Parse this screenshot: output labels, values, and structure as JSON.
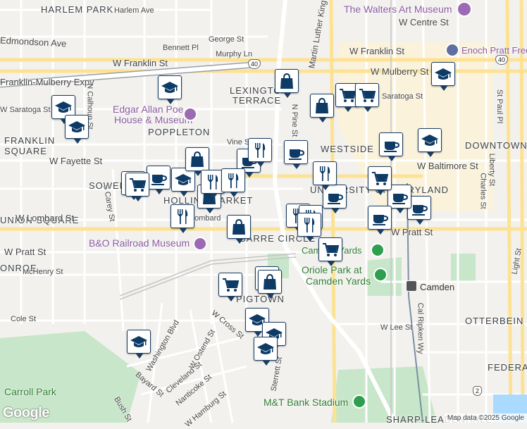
{
  "neighborhoods": [
    "HARLEM PARK",
    "LEXINGTON",
    "TERRACE",
    "POPPLETON",
    "FRANKLIN",
    "SQUARE",
    "WESTSIDE",
    "DOWNTOWN",
    "SOWEB",
    "HOLLINS MARKET",
    "UNION SQUARE",
    "BARRE CIRCLE",
    "PIGTOWN",
    "ONROE",
    "OTTERBEIN",
    "FEDERAL",
    "SHARP-LEADENHALL",
    "UNIVERSITY OF MARYLAND"
  ],
  "streets": [
    "Harlem Ave",
    "Edmondson Ave",
    "George St",
    "Bennett Pl",
    "Murphy Ln",
    "W Franklin St",
    "Franklin-Mulberry Expy",
    "W Franklin St",
    "W Mulberry St",
    "W Saratoga St",
    "Saratoga St",
    "Vine St",
    "W Fayette St",
    "W Baltimore St",
    "W Lombard St",
    "Lombard",
    "W Pratt St",
    "W Pratt St",
    "McHenry St",
    "Cole St",
    "W Cross St",
    "W Ostend St",
    "Washington Blvd",
    "Cleveland St",
    "Nanticoke St",
    "W Hamburg St",
    "Bayard St",
    "Bush St",
    "Sterrett St",
    "W Lee St",
    "Cal Ripken Wy",
    "Charles St",
    "Light St",
    "St Paul Pl",
    "Liberty St",
    "W Centre St",
    "S Carey St",
    "Martin Luther King Jr Blvd",
    "N Pine St",
    "W Pratt St",
    "W Mulberry St",
    "N Calhoun St",
    "W Baltimore St",
    "Charles St",
    "Ave",
    "Lexington"
  ],
  "pois": {
    "walters": "The Walters Art Museum",
    "pratt": "Enoch Pratt Free",
    "poe_line1": "Edgar Allan Poe",
    "poe_line2": "House & Museum",
    "bo": "B&O Railroad Museum",
    "camden_yards": "Camden Yards",
    "oriole_line1": "Oriole Park at",
    "oriole_line2": "Camden Yards",
    "camden": "Camden",
    "mt_bank": "M&T Bank Stadium",
    "carroll_park": "Carroll Park",
    "university_line1": "University",
    "university_line2": "of Baltimore",
    "maryland": "Maryland"
  },
  "shields": [
    "40",
    "40",
    "2"
  ],
  "pins": [
    {
      "type": "school"
    },
    {
      "type": "school"
    },
    {
      "type": "school"
    },
    {
      "type": "school"
    },
    {
      "type": "school"
    },
    {
      "type": "school"
    },
    {
      "type": "school"
    },
    {
      "type": "school"
    },
    {
      "type": "school"
    },
    {
      "type": "school"
    },
    {
      "type": "shop"
    },
    {
      "type": "shop"
    },
    {
      "type": "shop"
    },
    {
      "type": "shop"
    },
    {
      "type": "shop"
    },
    {
      "type": "shop"
    },
    {
      "type": "shop"
    },
    {
      "type": "cafe"
    },
    {
      "type": "cafe"
    },
    {
      "type": "cafe"
    },
    {
      "type": "cafe"
    },
    {
      "type": "cafe"
    },
    {
      "type": "cafe"
    },
    {
      "type": "cafe"
    },
    {
      "type": "cafe"
    },
    {
      "type": "cart"
    },
    {
      "type": "cart"
    },
    {
      "type": "cart"
    },
    {
      "type": "cart"
    },
    {
      "type": "cart"
    },
    {
      "type": "cart"
    },
    {
      "type": "cart"
    },
    {
      "type": "restaurant"
    },
    {
      "type": "restaurant"
    },
    {
      "type": "restaurant"
    },
    {
      "type": "restaurant"
    },
    {
      "type": "restaurant"
    },
    {
      "type": "restaurant"
    },
    {
      "type": "restaurant"
    },
    {
      "type": "restaurant"
    }
  ],
  "attribution": "Map data ©2025 Google",
  "logo": "Google",
  "colors": {
    "pin_border": "#1a3d63",
    "pin_icon": "#0d3b66",
    "park": "#c8e6c9",
    "highway": "#ffffff",
    "water": "#aadaff"
  }
}
